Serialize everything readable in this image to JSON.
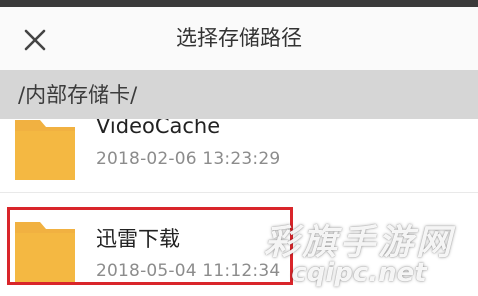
{
  "header": {
    "title": "选择存储路径",
    "close_icon": "close-icon"
  },
  "path": {
    "current": "/内部存储卡/"
  },
  "files": [
    {
      "name": "VideoCache",
      "modified": "2018-02-06 13:23:29",
      "icon": "folder-icon"
    },
    {
      "name": "迅雷下载",
      "modified": "2018-05-04 11:12:34",
      "icon": "folder-icon"
    }
  ],
  "watermark": {
    "text_cn": "彩旗手游网",
    "url": "cqipc.net"
  },
  "colors": {
    "folder": "#f1b141",
    "highlight": "#d9252a",
    "path_bar": "#d6d6d6"
  }
}
